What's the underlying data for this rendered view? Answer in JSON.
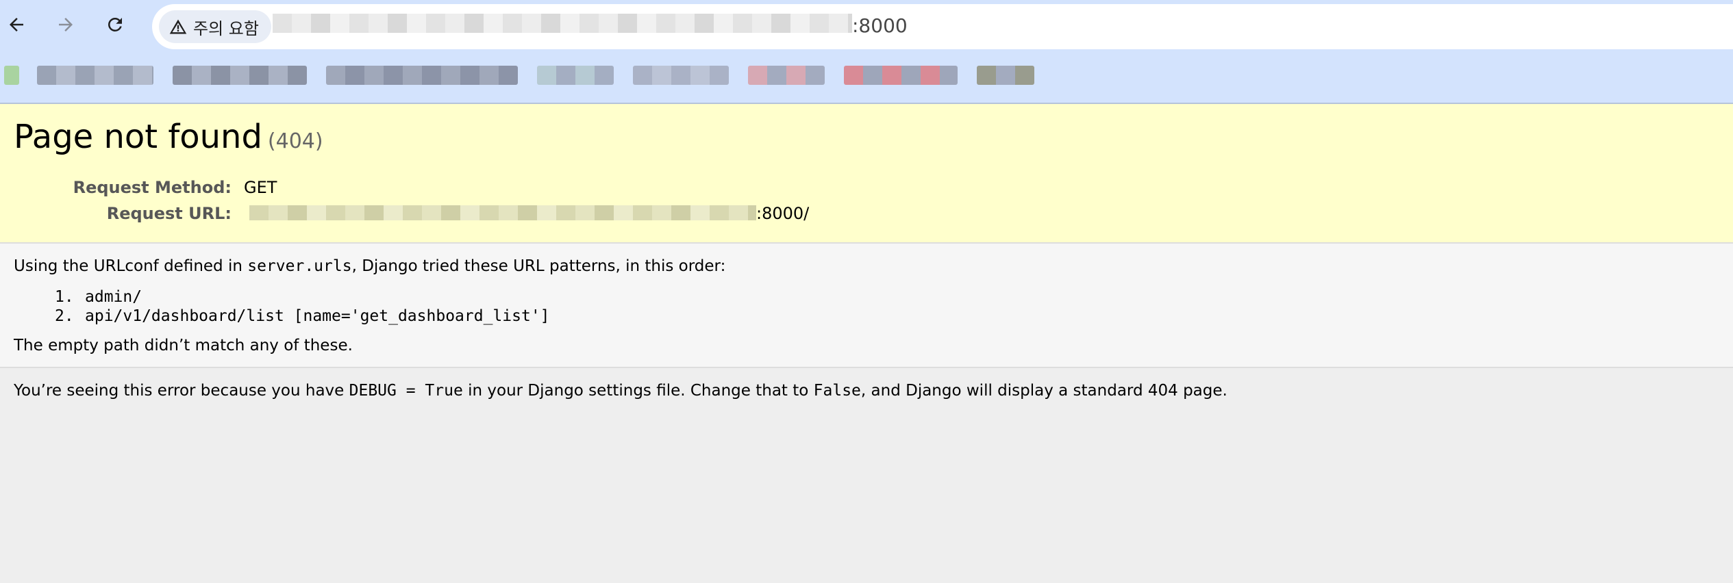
{
  "browser": {
    "security_chip_label": "주의 요함",
    "url_suffix": ":8000"
  },
  "page": {
    "title": "Page not found",
    "status_code": "(404)",
    "request": {
      "method_label": "Request Method:",
      "method_value": "GET",
      "url_label": "Request URL:",
      "url_suffix": ":8000/"
    },
    "info": {
      "intro_before": "Using the URLconf defined in ",
      "urlconf": "server.urls",
      "intro_after": ", Django tried these URL patterns, in this order:",
      "patterns": [
        {
          "num": "1.",
          "text": "admin/"
        },
        {
          "num": "2.",
          "text": "api/v1/dashboard/list [name='get_dashboard_list']"
        }
      ],
      "outro": "The empty path didn’t match any of these."
    },
    "explanation": {
      "part1": "You’re seeing this error because you have ",
      "code1": "DEBUG = True",
      "part2": " in your Django settings file. Change that to ",
      "code2": "False",
      "part3": ", and Django will display a standard 404 page."
    }
  },
  "colors": {
    "chrome_bg": "#d3e3fd",
    "summary_bg": "#ffffcc",
    "info_bg": "#f6f6f6",
    "explanation_bg": "#eeeeee"
  }
}
